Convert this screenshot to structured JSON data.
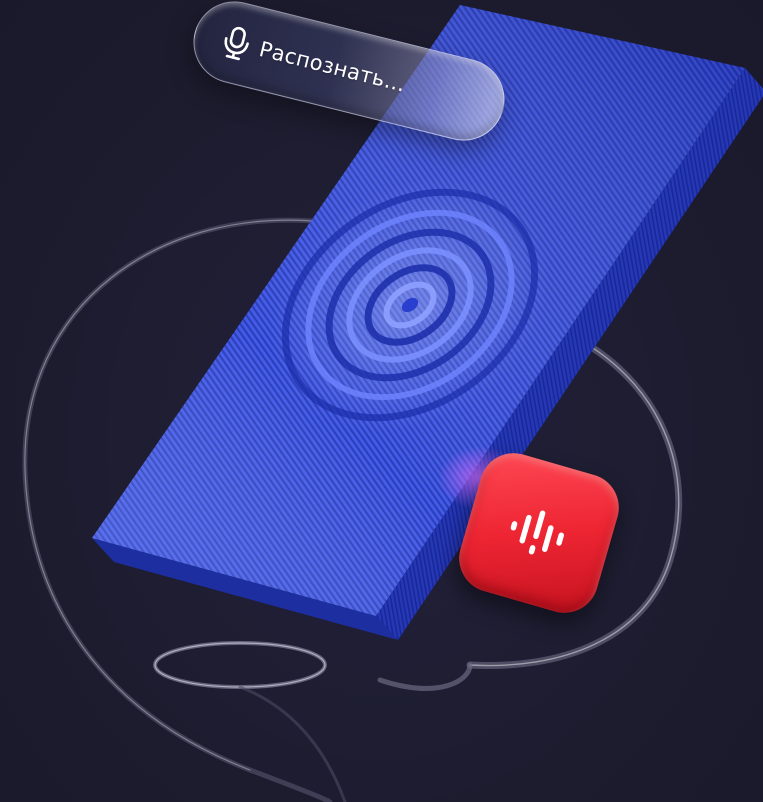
{
  "search_pill": {
    "label": "Распознать...",
    "icon": "microphone-icon"
  },
  "voice_app_icon": {
    "icon": "sound-wave-icon",
    "color": "#ee2533"
  },
  "colors": {
    "background": "#1e1d30",
    "panel": "#3047d6",
    "panel_side": "#2132a8",
    "accent_red": "#ee2533"
  }
}
